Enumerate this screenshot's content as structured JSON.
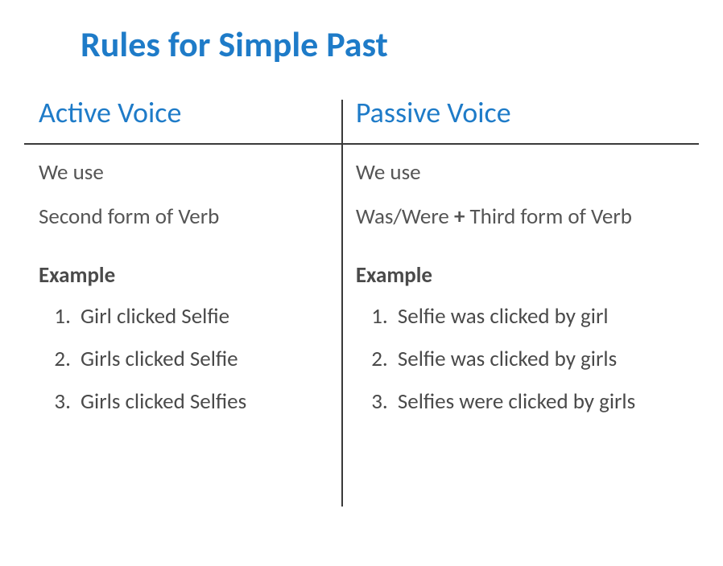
{
  "title": "Rules for Simple Past",
  "columns": {
    "active": {
      "header": "Active Voice",
      "intro1": "We use",
      "intro2": "Second form of Verb",
      "example_heading": "Example",
      "examples": [
        "Girl clicked Selfie",
        "Girls clicked Selfie",
        "Girls clicked Selfies"
      ]
    },
    "passive": {
      "header": "Passive Voice",
      "intro1": "We use",
      "intro2_pre": "Was/Were ",
      "plus": "+",
      "intro2_post": " Third form of Verb",
      "example_heading": "Example",
      "examples": [
        "Selfie was clicked by girl",
        "Selfie was clicked by girls",
        "Selfies were clicked by girls"
      ]
    }
  }
}
